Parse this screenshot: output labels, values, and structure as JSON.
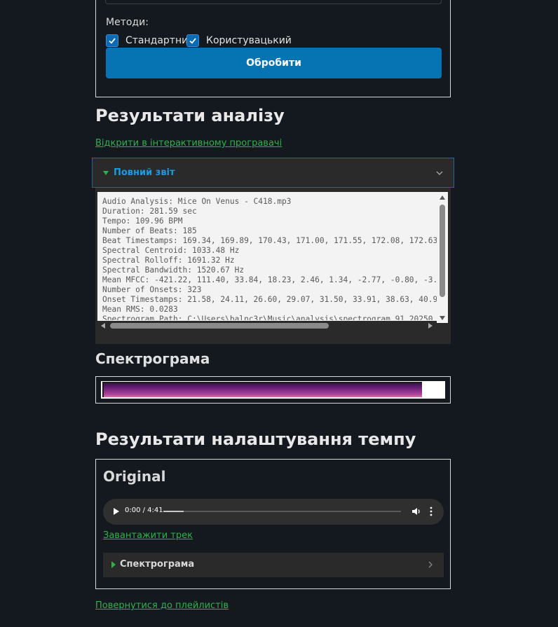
{
  "form": {
    "methods_label": "Методи:",
    "method_standard_label": "Стандартний",
    "method_custom_label": "Користувацький",
    "method_standard_checked": true,
    "method_custom_checked": true,
    "process_button": "Обробити"
  },
  "analysis": {
    "heading": "Результати аналізу",
    "open_player_link": "Відкрити в інтерактивному програвачі",
    "report_summary": "Повний звіт",
    "report_lines": [
      "Audio Analysis: Mice On Venus - C418.mp3",
      "Duration: 281.59 sec",
      "Tempo: 109.96 BPM",
      "Number of Beats: 185",
      "Beat Timestamps: 169.34, 169.89, 170.43, 171.00, 171.55, 172.08, 172.63",
      "Spectral Centroid: 1033.48 Hz",
      "Spectral Rolloff: 1691.32 Hz",
      "Spectral Bandwidth: 1520.67 Hz",
      "Mean MFCC: -421.22, 111.40, 33.84, 18.23, 2.46, 1.34, -2.77, -0.80, -3.",
      "Number of Onsets: 323",
      "Onset Timestamps: 21.58, 24.11, 26.60, 29.07, 31.50, 33.91, 38.63, 40.9",
      "Mean RMS: 0.0283",
      "Spectrogram Path: C:\\Users\\balnc3r\\Music\\analysis\\spectrogram_91_20250"
    ],
    "spectrogram_heading": "Спектрограма"
  },
  "tempo": {
    "heading": "Результати налаштування темпу",
    "original_title": "Original",
    "audio_time": "0:00 / 4:41",
    "audio_progress": 0.085,
    "download_link": "Завантажити трек",
    "spectrogram_summary": "Спектрограма"
  },
  "back_link": "Повернутися до плейлистів",
  "colors": {
    "background": "#141920",
    "accent_button": "#0674b3",
    "link": "#2fb14b",
    "summary_active": "#1b9be0"
  }
}
